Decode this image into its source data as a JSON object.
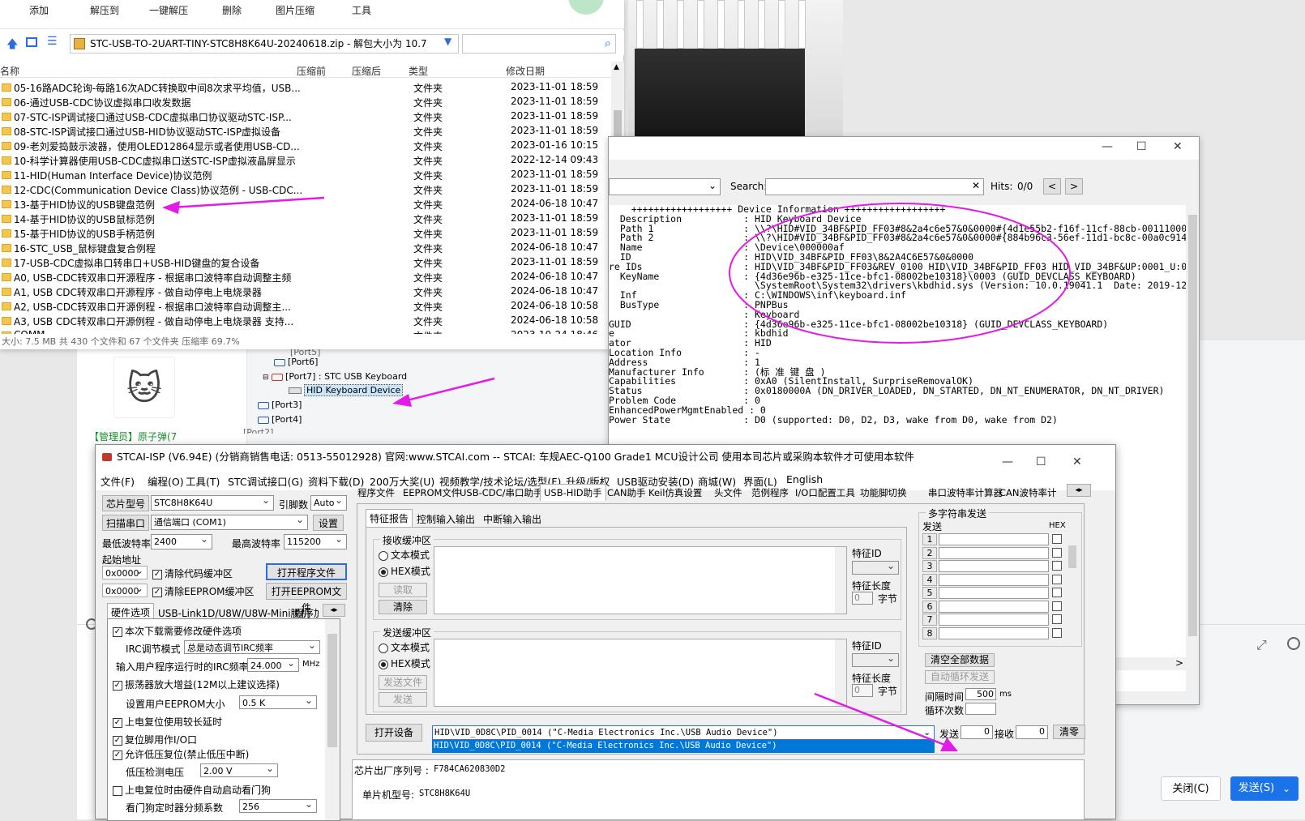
{
  "archive": {
    "toolbar": [
      "添加",
      "解压到",
      "一键解压",
      "删除",
      "图片压缩",
      "工具"
    ],
    "address": "STC-USB-TO-2UART-TINY-STC8H8K64U-20240618.zip - 解包大小为 10.7",
    "columns": {
      "name": "名称",
      "orig": "压缩前",
      "comp": "压缩后",
      "type": "类型",
      "date": "修改日期"
    },
    "rows": [
      {
        "name": "05-16路ADC轮询-每路16次ADC转换取中间8次求平均值，USB...",
        "type": "文件夹",
        "date": "2023-11-01 18:59"
      },
      {
        "name": "06-通过USB-CDC协议虚拟串口收发数据",
        "type": "文件夹",
        "date": "2023-11-01 18:59"
      },
      {
        "name": "07-STC-ISP调试接口通过USB-CDC虚拟串口协议驱动STC-ISP...",
        "type": "文件夹",
        "date": "2023-11-01 18:59"
      },
      {
        "name": "08-STC-ISP调试接口通过USB-HID协议驱动STC-ISP虚拟设备",
        "type": "文件夹",
        "date": "2023-11-01 18:59"
      },
      {
        "name": "09-老刘爱捣鼓示波器，使用OLED12864显示或者使用USB-CD...",
        "type": "文件夹",
        "date": "2023-01-16 10:15"
      },
      {
        "name": "10-科学计算器使用USB-CDC虚拟串口送STC-ISP虚拟液晶屏显示",
        "type": "文件夹",
        "date": "2022-12-14 09:43"
      },
      {
        "name": "11-HID(Human Interface Device)协议范例",
        "type": "文件夹",
        "date": "2023-11-01 18:59"
      },
      {
        "name": "12-CDC(Communication Device Class)协议范例 - USB-CDC...",
        "type": "文件夹",
        "date": "2023-11-01 18:59"
      },
      {
        "name": "13-基于HID协议的USB键盘范例",
        "type": "文件夹",
        "date": "2024-06-18 10:47"
      },
      {
        "name": "14-基于HID协议的USB鼠标范例",
        "type": "文件夹",
        "date": "2023-11-01 18:59"
      },
      {
        "name": "15-基于HID协议的USB手柄范例",
        "type": "文件夹",
        "date": "2023-11-01 18:59"
      },
      {
        "name": "16-STC_USB_鼠标键盘复合例程",
        "type": "文件夹",
        "date": "2024-06-18 10:47"
      },
      {
        "name": "17-USB-CDC虚拟串口转串口+USB-HID键盘的复合设备",
        "type": "文件夹",
        "date": "2023-11-01 18:59"
      },
      {
        "name": "A0, USB-CDC转双串口开源程序 - 根据串口波特率自动调整主频",
        "type": "文件夹",
        "date": "2024-06-18 10:47"
      },
      {
        "name": "A1, USB CDC转双串口开源程序 - 做自动停电上电烧录器",
        "type": "文件夹",
        "date": "2024-06-18 10:47"
      },
      {
        "name": "A2, USB-CDC转双串口开源例程 - 根据串口波特率自动调整主...",
        "type": "文件夹",
        "date": "2024-06-18 10:58"
      },
      {
        "name": "A3, USB CDC转双串口开源例程 - 做自动停电上电烧录器 支持...",
        "type": "文件夹",
        "date": "2024-06-18 10:58"
      },
      {
        "name": "COMM",
        "type": "文件夹",
        "date": "2023-10-24 18:46"
      }
    ],
    "status": "大小: 7.5 MB 共 430 个文件和 67 个文件夹 压缩率 69.7%"
  },
  "tree": {
    "items": [
      "[Port6]",
      "[Port7] : STC USB Keyboard",
      "HID Keyboard Device",
      "[Port3]",
      "[Port4]"
    ],
    "cut_top": "[Port5]",
    "cut_bottom": "[Port2]"
  },
  "forum": {
    "admin": "【管理员】原子弹(7"
  },
  "devwin": {
    "search_label": "Search:",
    "hits_label": "Hits:",
    "hits": "0/0",
    "lines": [
      "    ++++++++++++++++++ Device Information ++++++++++++++++++",
      "  Description           : HID Keyboard Device",
      "  Path 1                : \\\\?\\HID#VID_34BF&PID_FF03#8&2a4c6e57&0&0000#{4d1e55b2-f16f-11cf-88cb-00111000",
      "  Path 2                : \\\\?\\HID#VID_34BF&PID_FF03#8&2a4c6e57&0&0000#{884b96c3-56ef-11d1-bc8c-00a0c914",
      "  Name                  : \\Device\\000000af",
      "  ID                    : HID\\VID_34BF&PID_FF03\\8&2A4C6E57&0&0000",
      "re IDs                  : HID\\VID_34BF&PID_FF03&REV_0100 HID\\VID_34BF&PID_FF03 HID_VID_34BF&UP:0001_U:0",
      "  KeyName               : {4d36e96b-e325-11ce-bfc1-08002be10318}\\0003 (GUID_DEVCLASS_KEYBOARD)",
      "                          \\SystemRoot\\System32\\drivers\\kbdhid.sys (Version: 10.0.19041.1  Date: 2019-12",
      "  Inf                   : C:\\WINDOWS\\inf\\keyboard.inf",
      "  BusType               : PNPBus",
      "                        : Keyboard",
      "GUID                    : {4d36e96b-e325-11ce-bfc1-08002be10318} (GUID_DEVCLASS_KEYBOARD)",
      "e                       : kbdhid",
      "ator                    : HID",
      "Location Info           : -",
      "Address                 : 1",
      "Manufacturer Info       : (标 准 键 盘 )",
      "Capabilities            : 0xA0 (SilentInstall, SurpriseRemovalOK)",
      "Status                  : 0x0180000A (DN_DRIVER_LOADED, DN_STARTED, DN_NT_ENUMERATOR, DN_NT_DRIVER)",
      "Problem Code            : 0",
      "EnhancedPowerMgmtEnabled : 0",
      "Power State             : D0 (supported: D0, D2, D3, wake from D0, wake from D2)"
    ]
  },
  "isp": {
    "title": "STCAI-ISP (V6.94E) (分销商销售电话: 0513-55012928) 官网:www.STCAI.com  -- STCAI: 车规AEC-Q100 Grade1 MCU设计公司 使用本司芯片或采购本软件才可使用本软件",
    "menu": [
      "文件(F)",
      "编程(O)",
      "工具(T)",
      "STC调试接口(G)",
      "资料下载(D)",
      "200万大奖(U)",
      "视频教学/技术论坛/选型(F)",
      "升级/版权",
      "USB驱动安装(D)",
      "商城(W)",
      "界面(L)",
      "English"
    ],
    "left": {
      "chip_label": "芯片型号",
      "chip": "STC8H8K64U",
      "pins_label": "引脚数",
      "pins": "Auto",
      "scan": "扫描串口",
      "port": "通信端口 (COM1)",
      "settings": "设置",
      "minbaud_label": "最低波特率",
      "minbaud": "2400",
      "maxbaud_label": "最高波特率",
      "maxbaud": "115200",
      "start_label": "起始地址",
      "addr1": "0x0000",
      "clear_code": "清除代码缓冲区",
      "open_prog": "打开程序文件",
      "addr2": "0x0000",
      "clear_eeprom": "清除EEPROM缓冲区",
      "open_eeprom": "打开EEPROM文件",
      "tabs": [
        "硬件选项",
        "USB-Link1D/U8W/U8W-Mini脱机",
        "程序加"
      ],
      "opts": [
        {
          "chk": "☑",
          "text": "本次下载需要修改硬件选项"
        },
        {
          "chk": "",
          "text": "IRC调节模式"
        },
        {
          "chk": "",
          "text": "输入用户程序运行时的IRC频率"
        },
        {
          "chk": "☑",
          "text": "振荡器放大增益(12M以上建议选择)"
        },
        {
          "chk": "",
          "text": "设置用户EEPROM大小"
        },
        {
          "chk": "☑",
          "text": "上电复位使用较长延时"
        },
        {
          "chk": "☑",
          "text": "复位脚用作I/O口"
        },
        {
          "chk": "☑",
          "text": "允许低压复位(禁止低压中断)"
        },
        {
          "chk": "",
          "text": "低压检测电压"
        },
        {
          "chk": "☐",
          "text": "上电复位时由硬件自动启动看门狗"
        },
        {
          "chk": "",
          "text": "看门狗定时器分频系数"
        }
      ],
      "irc_mode": "总是动态调节IRC频率",
      "irc_freq": "24.000",
      "mhz": "MHz",
      "eeprom": "0.5 K",
      "lvd": "2.00 V",
      "wdt": "256"
    },
    "tabs": [
      "程序文件",
      "EEPROM文件",
      "USB-CDC/串口助手",
      "USB-HID助手",
      "CAN助手",
      "Keil仿真设置",
      "头文件",
      "范例程序",
      "I/O口配置工具",
      "功能脚切换",
      "串口波特率计算器",
      "CAN波特率计"
    ],
    "subtabs": [
      "特征报告",
      "控制输入输出",
      "中断输入输出"
    ],
    "recv": {
      "title": "接收缓冲区",
      "text_mode": "文本模式",
      "hex_mode": "HEX模式",
      "read": "读取",
      "clear": "清除",
      "id_label": "特征ID",
      "len_label": "特征长度",
      "len": "0",
      "unit": "字节"
    },
    "send": {
      "title": "发送缓冲区",
      "text_mode": "文本模式",
      "hex_mode": "HEX模式",
      "send_file": "发送文件",
      "send": "发送",
      "id_label": "特征ID",
      "len_label": "特征长度",
      "len": "0",
      "unit": "字节"
    },
    "multi": {
      "title": "多字符串发送",
      "send": "发送",
      "hex": "HEX",
      "nums": [
        "1",
        "2",
        "3",
        "4",
        "5",
        "6",
        "7",
        "8"
      ],
      "clear_all": "清空全部数据",
      "auto": "自动循环发送",
      "interval_label": "间隔时间",
      "interval": "500",
      "ms": "ms",
      "loop_label": "循环次数"
    },
    "open_dev": "打开设备",
    "device": "HID\\VID_0D8C\\PID_0014 (\"C-Media Electronics Inc.\\USB Audio Device\")",
    "device_opt": "HID\\VID_0D8C\\PID_0014 (\"C-Media Electronics Inc.\\USB Audio Device\")",
    "send_lbl": "发送",
    "send_cnt": "0",
    "recv_lbl": "接收",
    "recv_cnt": "0",
    "clear_cnt": "清零",
    "serial_label": "芯片出厂序列号 :",
    "serial": "F784CA620830D2",
    "mcu_label": "单片机型号:",
    "mcu": "STC8H8K64U"
  },
  "dialog": {
    "close": "关闭(C)",
    "send": "发送(S)"
  },
  "colors": {
    "arrow": "#e21be7",
    "accent": "#1a73e8"
  }
}
